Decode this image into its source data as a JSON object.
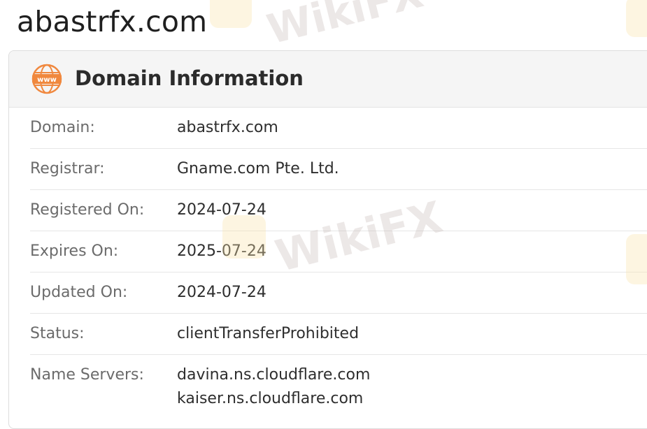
{
  "page": {
    "title": "abastrfx.com"
  },
  "card": {
    "title": "Domain Information",
    "icon": "www-globe-icon"
  },
  "rows": [
    {
      "label": "Domain:",
      "value": "abastrfx.com"
    },
    {
      "label": "Registrar:",
      "value": "Gname.com Pte. Ltd."
    },
    {
      "label": "Registered On:",
      "value": "2024-07-24"
    },
    {
      "label": "Expires On:",
      "value": "2025-07-24"
    },
    {
      "label": "Updated On:",
      "value": "2024-07-24"
    },
    {
      "label": "Status:",
      "value": "clientTransferProhibited"
    }
  ],
  "name_servers": {
    "label": "Name Servers:",
    "values": [
      "davina.ns.cloudflare.com",
      "kaiser.ns.cloudflare.com"
    ]
  },
  "watermark": {
    "text": "WikiFX"
  },
  "colors": {
    "icon_accent": "#f0883e",
    "header_bg": "#f5f5f5",
    "label": "#6b6b6b"
  }
}
